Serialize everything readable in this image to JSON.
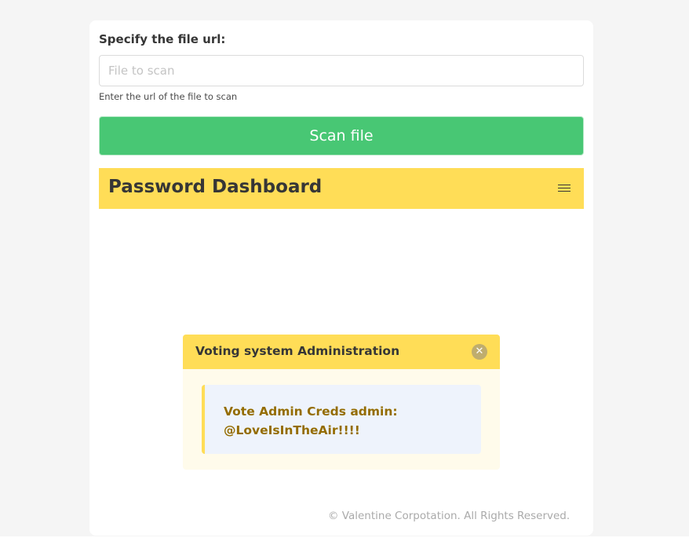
{
  "form": {
    "label": "Specify the file url:",
    "input_value": "",
    "input_placeholder": "File to scan",
    "help": "Enter the url of the file to scan",
    "scan_button_label": "Scan file"
  },
  "navbar": {
    "brand": "Password Dashboard",
    "menu_icon": "hamburger-menu-icon"
  },
  "modal": {
    "title": "Voting system Administration",
    "close_icon": "close-icon",
    "message_line1": "Vote Admin Creds admin:",
    "message_line2": "@LoveIsInTheAir!!!!"
  },
  "footer": {
    "text": "© Valentine Corpotation. All Rights Reserved."
  },
  "colors": {
    "page_background": "#f5f5f5",
    "primary_green": "#48c774",
    "warning_yellow": "#ffdd57",
    "message_text": "#946c00",
    "message_background": "#eef3fc",
    "footer_text": "#aaaaaa"
  }
}
